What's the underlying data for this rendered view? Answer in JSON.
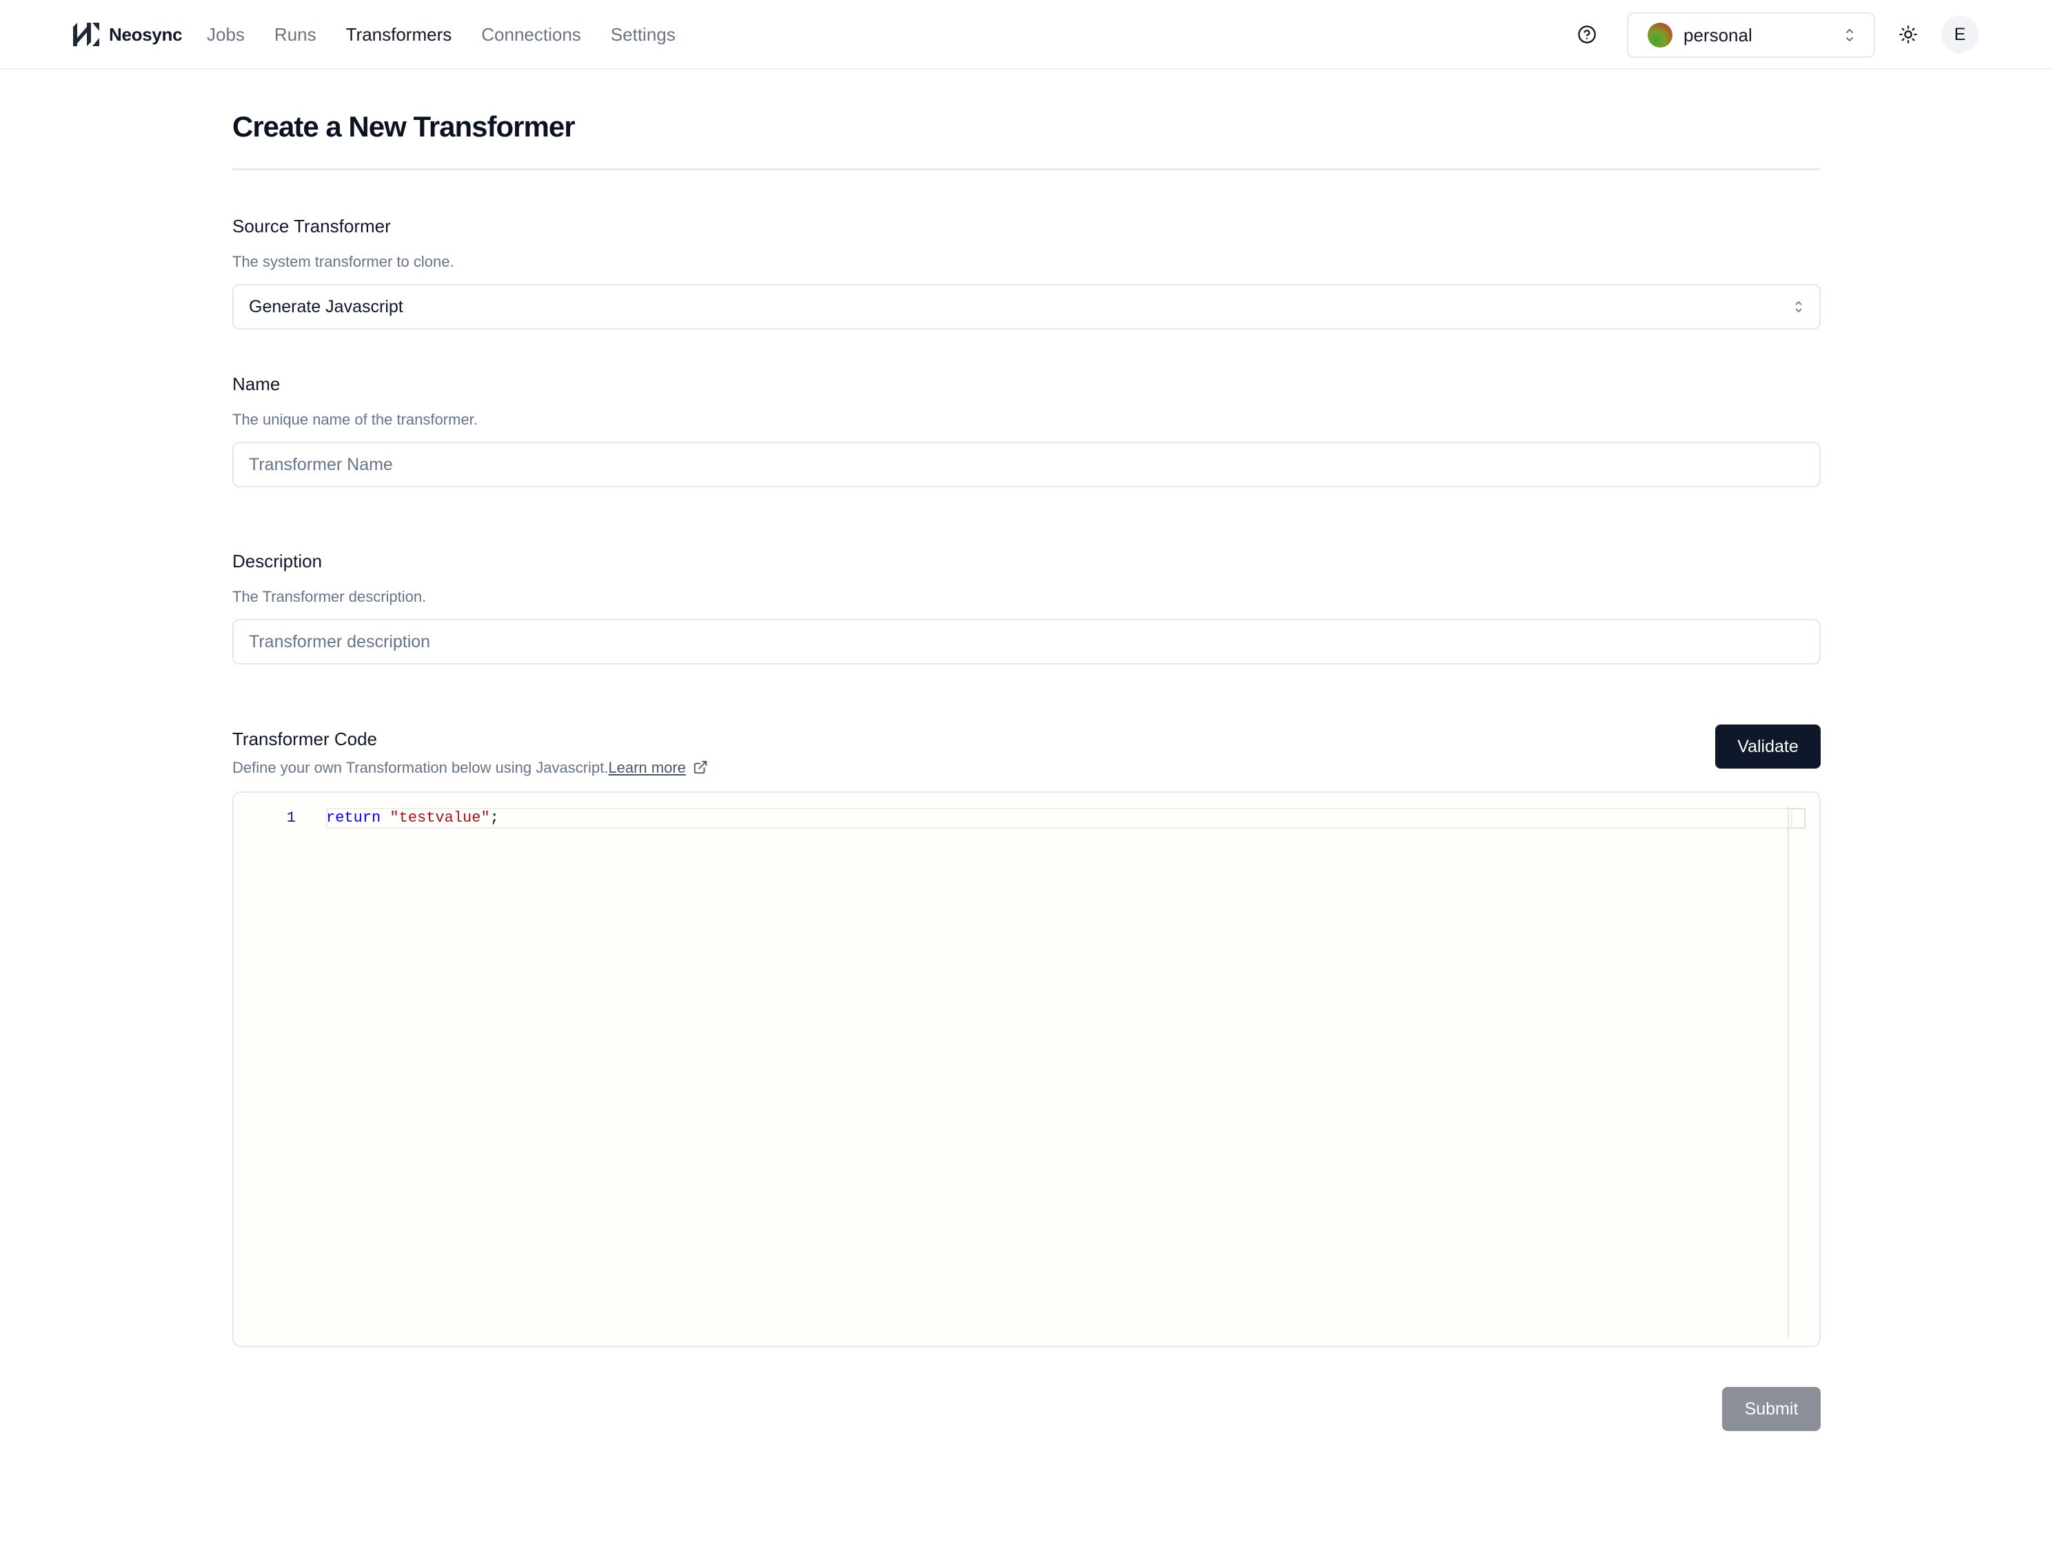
{
  "app": {
    "brand_name": "Neosync"
  },
  "nav": {
    "links": [
      {
        "label": "Jobs",
        "active": false
      },
      {
        "label": "Runs",
        "active": false
      },
      {
        "label": "Transformers",
        "active": true
      },
      {
        "label": "Connections",
        "active": false
      },
      {
        "label": "Settings",
        "active": false
      }
    ]
  },
  "header_right": {
    "help_icon": "help-circle-icon",
    "account": {
      "name": "personal"
    },
    "theme_icon": "sun-icon",
    "avatar_initial": "E"
  },
  "page": {
    "title": "Create a New Transformer"
  },
  "form": {
    "source": {
      "label": "Source Transformer",
      "help": "The system transformer to clone.",
      "value": "Generate Javascript"
    },
    "name": {
      "label": "Name",
      "help": "The unique name of the transformer.",
      "value": "",
      "placeholder": "Transformer Name"
    },
    "description": {
      "label": "Description",
      "help": "The Transformer description.",
      "value": "",
      "placeholder": "Transformer description"
    },
    "code": {
      "label": "Transformer Code",
      "help": "Define your own Transformation below using Javascript.",
      "learn_more": "Learn more",
      "validate_label": "Validate",
      "line_number": "1",
      "tokens": {
        "keyword": "return",
        "space": " ",
        "string": "\"testvalue\"",
        "punct": ";"
      }
    },
    "submit_label": "Submit"
  },
  "colors": {
    "primary_button": "#0f172a",
    "submit_disabled": "#8a8f98",
    "muted_text": "#64748b",
    "code_keyword": "#0000ff",
    "code_string": "#a31515"
  }
}
